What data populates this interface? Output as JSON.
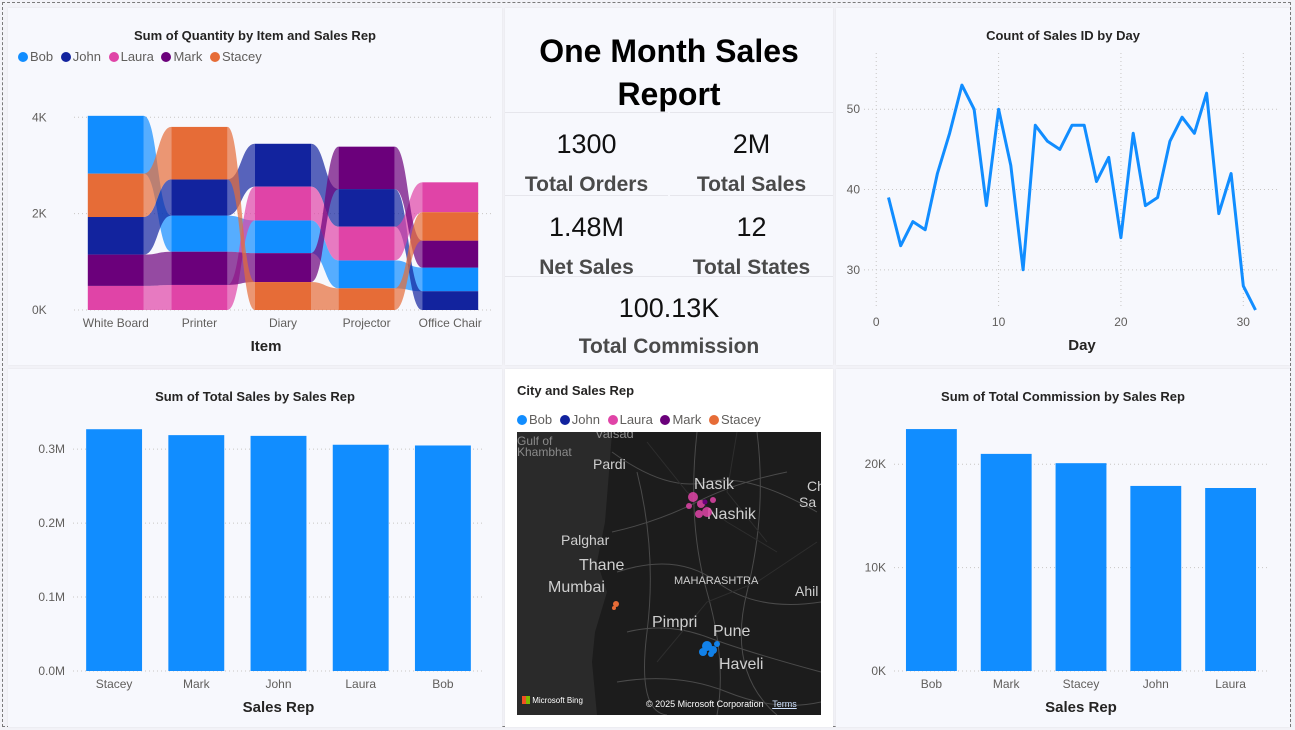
{
  "report_title": "One Month Sales Report",
  "sales_reps": [
    {
      "name": "Bob",
      "color": "#118dff"
    },
    {
      "name": "John",
      "color": "#12239e"
    },
    {
      "name": "Laura",
      "color": "#e044a7"
    },
    {
      "name": "Mark",
      "color": "#6b007b"
    },
    {
      "name": "Stacey",
      "color": "#e66c37"
    }
  ],
  "kpis": {
    "total_orders": {
      "value": "1300",
      "label": "Total Orders"
    },
    "total_sales": {
      "value": "2M",
      "label": "Total Sales"
    },
    "net_sales": {
      "value": "1.48M",
      "label": "Net Sales"
    },
    "total_states": {
      "value": "12",
      "label": "Total States"
    },
    "total_commission": {
      "value": "100.13K",
      "label": "Total Commission"
    }
  },
  "map": {
    "title": "City and Sales Rep",
    "places": [
      "Valsad",
      "Gulf of Khambhat",
      "Pardi",
      "Nasik",
      "Nashik",
      "Palghar",
      "Thane",
      "Mumbai",
      "MAHARASHTRA",
      "Ahil",
      "Pimpri",
      "Pune",
      "Haveli",
      "Ch",
      "Sa"
    ],
    "brand": "Microsoft Bing",
    "copyright": "© 2025 Microsoft Corporation",
    "terms": "Terms"
  },
  "chart_data": [
    {
      "type": "bar",
      "subtype": "ribbon",
      "title": "Sum of Quantity by Item and Sales Rep",
      "xlabel": "Item",
      "ylabel": "",
      "categories": [
        "White Board",
        "Printer",
        "Diary",
        "Projector",
        "Office Chair"
      ],
      "yticks": [
        "0K",
        "2K",
        "4K"
      ],
      "ylim": [
        0,
        4400
      ],
      "series": [
        {
          "name": "Bob",
          "values": [
            1200,
            750,
            680,
            580,
            490
          ]
        },
        {
          "name": "John",
          "values": [
            780,
            750,
            890,
            780,
            390
          ]
        },
        {
          "name": "Laura",
          "values": [
            500,
            520,
            700,
            700,
            620
          ]
        },
        {
          "name": "Mark",
          "values": [
            650,
            690,
            600,
            880,
            560
          ]
        },
        {
          "name": "Stacey",
          "values": [
            900,
            1090,
            580,
            450,
            590
          ]
        }
      ]
    },
    {
      "type": "line",
      "title": "Count of Sales ID by Day",
      "xlabel": "Day",
      "ylabel": "",
      "xticks": [
        "0",
        "10",
        "20",
        "30"
      ],
      "yticks": [
        "30",
        "40",
        "50"
      ],
      "xlim": [
        -1,
        33
      ],
      "ylim": [
        24,
        57
      ],
      "x": [
        1,
        2,
        3,
        4,
        5,
        6,
        7,
        8,
        9,
        10,
        11,
        12,
        13,
        14,
        15,
        16,
        17,
        18,
        19,
        20,
        21,
        22,
        23,
        24,
        25,
        26,
        27,
        28,
        29,
        30,
        31
      ],
      "values": [
        39,
        33,
        36,
        35,
        42,
        47,
        53,
        50,
        38,
        50,
        43,
        30,
        48,
        46,
        45,
        48,
        48,
        41,
        44,
        34,
        47,
        38,
        39,
        46,
        49,
        47,
        52,
        37,
        42,
        28,
        25
      ]
    },
    {
      "type": "bar",
      "title": "Sum of Total Sales by Sales Rep",
      "xlabel": "Sales Rep",
      "ylabel": "",
      "categories": [
        "Stacey",
        "Mark",
        "John",
        "Laura",
        "Bob"
      ],
      "values": [
        0.327,
        0.319,
        0.318,
        0.306,
        0.305
      ],
      "yticks": [
        "0.0M",
        "0.1M",
        "0.2M",
        "0.3M"
      ],
      "ylim": [
        0,
        0.33
      ],
      "color": "#118dff"
    },
    {
      "type": "bar",
      "title": "Sum of Total Commission by Sales Rep",
      "xlabel": "Sales Rep",
      "ylabel": "",
      "categories": [
        "Bob",
        "Mark",
        "Stacey",
        "John",
        "Laura"
      ],
      "values": [
        23400,
        21000,
        20100,
        17900,
        17700
      ],
      "yticks": [
        "0K",
        "10K",
        "20K"
      ],
      "ylim": [
        0,
        23600
      ],
      "color": "#118dff"
    }
  ]
}
